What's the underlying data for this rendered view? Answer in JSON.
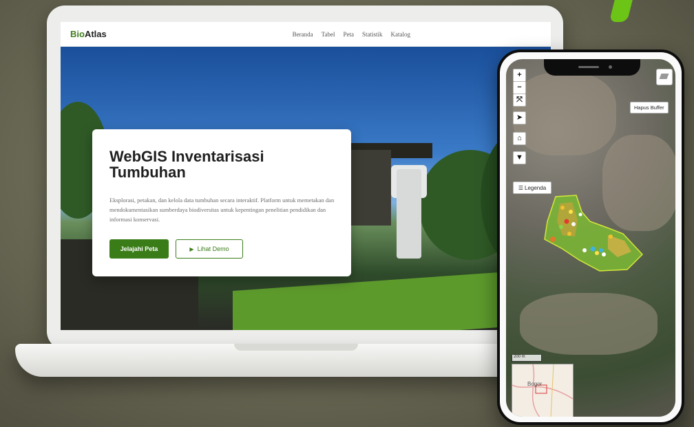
{
  "laptop": {
    "logo": {
      "part1": "Bio",
      "part2": "Atlas"
    },
    "nav": [
      "Beranda",
      "Tabel",
      "Peta",
      "Statistik",
      "Katalog"
    ],
    "hero": {
      "title": "WebGIS Inventarisasi Tumbuhan",
      "description": "Eksplorasi, petakan, dan kelola data tumbuhan secara interaktif. Platform untuk memetakan dan mendokumentasikan sumberdaya biodiversitas untuk kepentingan penelitian pendidikan dan informasi konservasi.",
      "primary_button": "Jelajahi Peta",
      "secondary_button": "Lihat Demo"
    }
  },
  "phone": {
    "map_controls": [
      "+",
      "−",
      "⤧",
      "➤",
      "⌂",
      "▼"
    ],
    "hapus_buffer": "Hapus Buffer",
    "legenda": "Legenda",
    "scale_label": "200 m",
    "minimap_label": "Bogor"
  },
  "colors": {
    "accent": "#3a7d18",
    "logo_green": "#3f7f1d",
    "background": "#6e6d58",
    "study_area": "#7bb834"
  }
}
